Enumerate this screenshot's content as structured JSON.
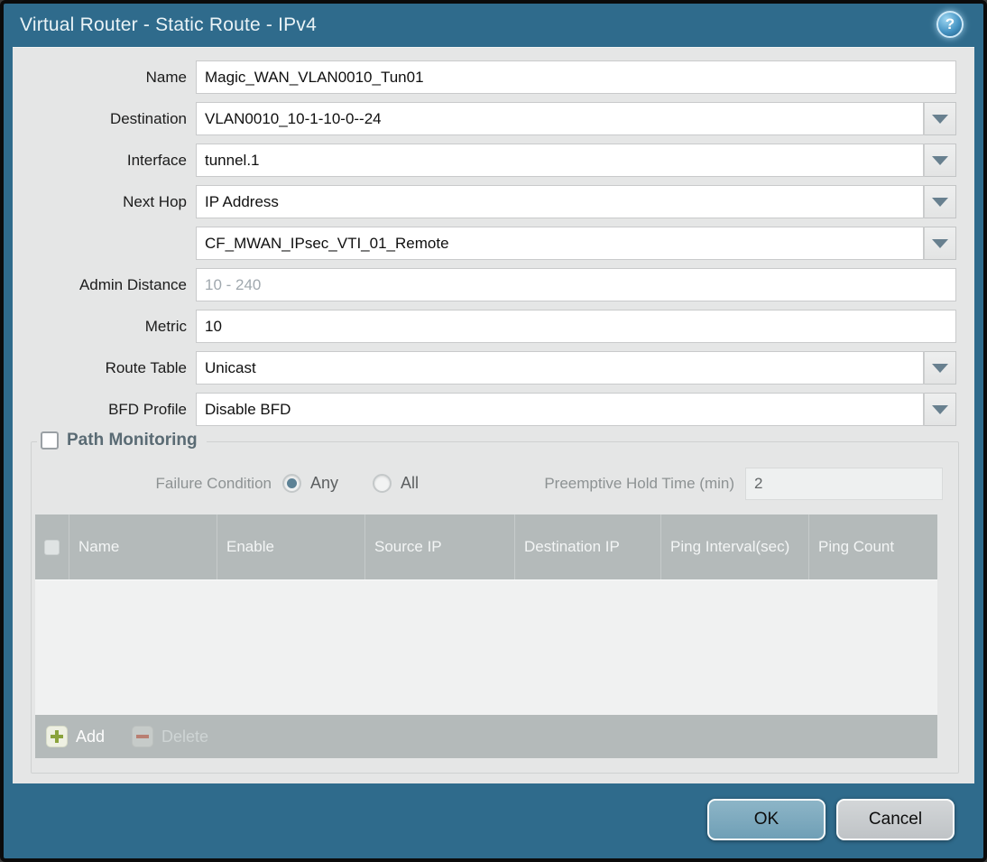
{
  "dialog": {
    "title": "Virtual Router - Static Route - IPv4",
    "help_icon": "?",
    "ok_label": "OK",
    "cancel_label": "Cancel"
  },
  "form": {
    "fields": [
      {
        "label": "Name",
        "value": "Magic_WAN_VLAN0010_Tun01",
        "type": "text"
      },
      {
        "label": "Destination",
        "value": "VLAN0010_10-1-10-0--24",
        "type": "dropdown"
      },
      {
        "label": "Interface",
        "value": "tunnel.1",
        "type": "dropdown"
      },
      {
        "label": "Next Hop",
        "value": "IP Address",
        "type": "dropdown"
      },
      {
        "label": "",
        "value": "CF_MWAN_IPsec_VTI_01_Remote",
        "type": "dropdown"
      },
      {
        "label": "Admin Distance",
        "value": "",
        "placeholder": "10 - 240",
        "type": "text"
      },
      {
        "label": "Metric",
        "value": "10",
        "type": "text"
      },
      {
        "label": "Route Table",
        "value": "Unicast",
        "type": "dropdown"
      },
      {
        "label": "BFD Profile",
        "value": "Disable BFD",
        "type": "dropdown"
      }
    ]
  },
  "path_monitoring": {
    "title": "Path Monitoring",
    "checkbox_checked": false,
    "failure_condition_label": "Failure Condition",
    "radio_any_label": "Any",
    "radio_all_label": "All",
    "radio_selected": "Any",
    "preemptive_label": "Preemptive Hold Time (min)",
    "preemptive_value": "2",
    "table": {
      "columns": [
        "Name",
        "Enable",
        "Source IP",
        "Destination IP",
        "Ping Interval(sec)",
        "Ping Count"
      ],
      "rows": []
    },
    "add_label": "Add",
    "delete_label": "Delete"
  },
  "colors": {
    "frame_teal": "#2f6b8c",
    "panel_bg": "#e5e6e6",
    "table_header_gray": "#b4baba",
    "ok_button_blue": "#7ba6bb",
    "add_plus_green": "#8aa33c",
    "delete_minus_red": "#b97f72",
    "legend_slate": "#5a6b74"
  }
}
